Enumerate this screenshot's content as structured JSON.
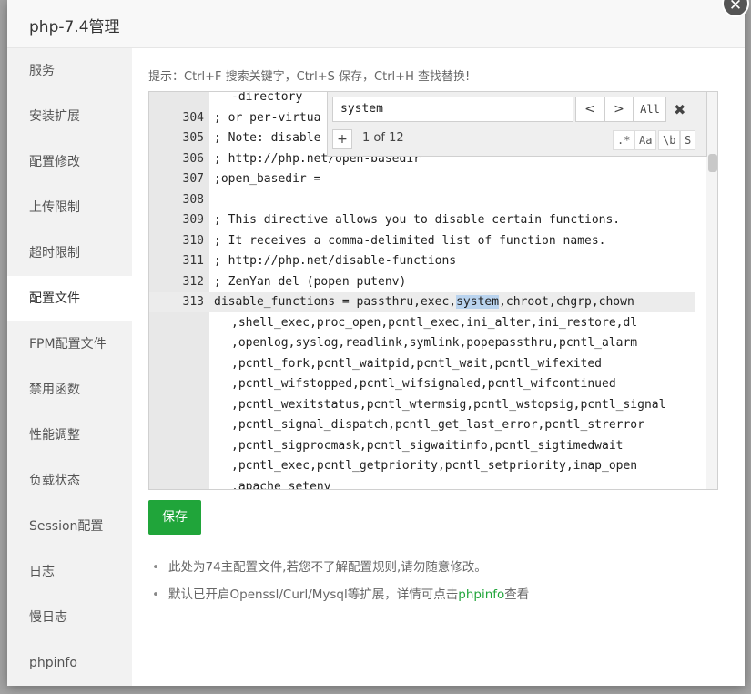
{
  "window": {
    "title": "php-7.4管理",
    "close_glyph": "✕"
  },
  "sidebar": {
    "items": [
      {
        "label": "服务"
      },
      {
        "label": "安装扩展"
      },
      {
        "label": "配置修改"
      },
      {
        "label": "上传限制"
      },
      {
        "label": "超时限制"
      },
      {
        "label": "配置文件",
        "active": true
      },
      {
        "label": "FPM配置文件"
      },
      {
        "label": "禁用函数"
      },
      {
        "label": "性能调整"
      },
      {
        "label": "负载状态"
      },
      {
        "label": "Session配置"
      },
      {
        "label": "日志"
      },
      {
        "label": "慢日志"
      },
      {
        "label": "phpinfo"
      }
    ]
  },
  "main": {
    "hint": "提示：Ctrl+F 搜索关键字，Ctrl+S 保存，Ctrl+H 查找替换!",
    "save_label": "保存",
    "notes": {
      "note1": "此处为74主配置文件,若您不了解配置规则,请勿随意修改。",
      "note2_prefix": "默认已开启Openssl/Curl/Mysql等扩展，详情可点击",
      "note2_link": "phpinfo",
      "note2_suffix": "查看"
    }
  },
  "search": {
    "value": "system",
    "prev": "<",
    "next": ">",
    "all": "All",
    "close": "✖",
    "replace_toggle": "+",
    "counter": "1 of 12",
    "opt_regex": ".*",
    "opt_case": "Aa",
    "opt_word": "\\b",
    "opt_selection": "S"
  },
  "editor": {
    "lines": [
      {
        "num": "",
        "code": "-directory",
        "cont": true
      },
      {
        "num": "304",
        "code": "; or per-virtua"
      },
      {
        "num": "305",
        "code": "; Note: disable"
      },
      {
        "num": "306",
        "code": "; http://php.net/open-basedir"
      },
      {
        "num": "307",
        "code": ";open_basedir ="
      },
      {
        "num": "308",
        "code": ""
      },
      {
        "num": "309",
        "code": "; This directive allows you to disable certain functions."
      },
      {
        "num": "310",
        "code": "; It receives a comma-delimited list of function names."
      },
      {
        "num": "311",
        "code": "; http://php.net/disable-functions"
      },
      {
        "num": "312",
        "code": "; ZenYan del (popen putenv)"
      },
      {
        "num": "313",
        "code_pre": "disable_functions = passthru,exec,",
        "code_hl": "system",
        "code_post": ",chroot,chgrp,chown",
        "active": true
      },
      {
        "num": "",
        "code": ",shell_exec,proc_open,pcntl_exec,ini_alter,ini_restore,dl",
        "cont": true
      },
      {
        "num": "",
        "code": ",openlog,syslog,readlink,symlink,popepassthru,pcntl_alarm",
        "cont": true
      },
      {
        "num": "",
        "code": ",pcntl_fork,pcntl_waitpid,pcntl_wait,pcntl_wifexited",
        "cont": true
      },
      {
        "num": "",
        "code": ",pcntl_wifstopped,pcntl_wifsignaled,pcntl_wifcontinued",
        "cont": true
      },
      {
        "num": "",
        "code": ",pcntl_wexitstatus,pcntl_wtermsig,pcntl_wstopsig,pcntl_signal",
        "cont": true
      },
      {
        "num": "",
        "code": ",pcntl_signal_dispatch,pcntl_get_last_error,pcntl_strerror",
        "cont": true
      },
      {
        "num": "",
        "code": ",pcntl_sigprocmask,pcntl_sigwaitinfo,pcntl_sigtimedwait",
        "cont": true
      },
      {
        "num": "",
        "code": ",pcntl_exec,pcntl_getpriority,pcntl_setpriority,imap_open",
        "cont": true
      },
      {
        "num": "",
        "code": ",apache_setenv",
        "cont": true
      }
    ]
  }
}
